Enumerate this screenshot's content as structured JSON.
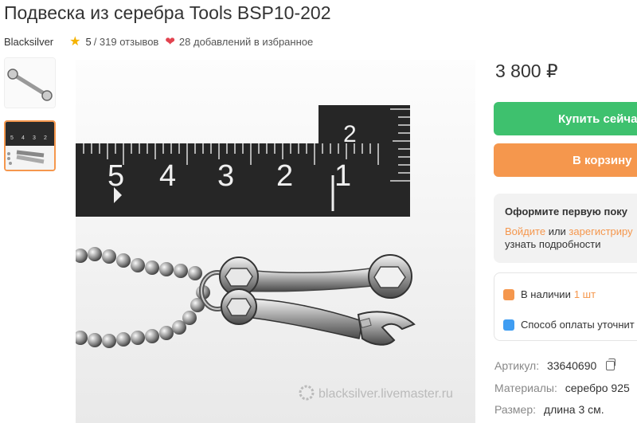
{
  "product": {
    "title": "Подвеска из серебра Tools BSP10-202",
    "shop": "Blacksilver",
    "rating": "5",
    "reviews": "/ 319 отзывов",
    "favorites": "28 добавлений в избранное",
    "price": "3 800 ₽"
  },
  "gallery": {
    "watermark": "blacksilver.livemaster.ru",
    "ruler_labels": [
      "5",
      "4",
      "3",
      "2",
      "1",
      "2"
    ]
  },
  "actions": {
    "buy_label": "Купить сейча",
    "cart_label": "В корзину"
  },
  "promo": {
    "title": "Оформите первую поку",
    "login": "Войдите",
    "or": "или",
    "register": "зарегистриру",
    "details": "узнать подробности"
  },
  "availability": {
    "in_stock": "В наличии",
    "count": "1 шт",
    "payment": "Способ оплаты уточнит"
  },
  "specs": {
    "article_label": "Артикул:",
    "article_value": "33640690",
    "materials_label": "Материалы:",
    "materials_value": "серебро 925",
    "size_label": "Размер:",
    "size_value": "длина 3 см."
  },
  "colors": {
    "accent_green": "#3ec16e",
    "accent_orange": "#f5974d",
    "heart": "#e2434f",
    "star": "#f5b301",
    "chat_icon": "#3f9df2"
  },
  "icons": [
    "star-icon",
    "heart-icon",
    "bag-icon",
    "chat-icon",
    "copy-icon",
    "watermark-logo-icon"
  ]
}
